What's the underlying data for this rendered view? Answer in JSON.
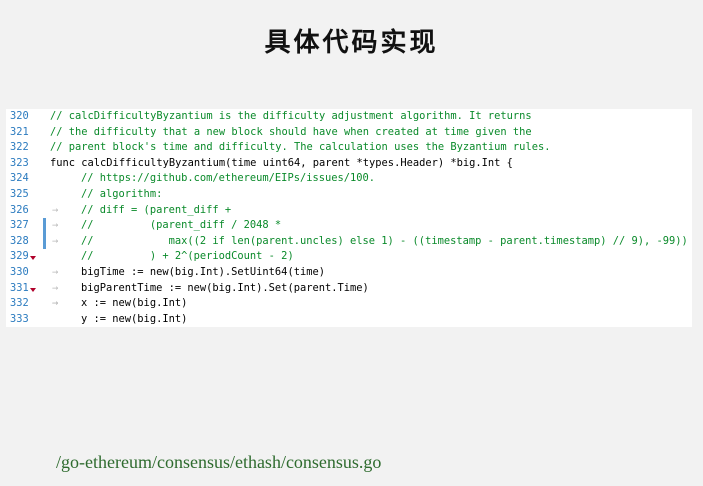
{
  "slide": {
    "title": "具体代码实现",
    "source_path": "/go-ethereum/consensus/ethash/consensus.go"
  },
  "editor": {
    "lines": [
      {
        "number": "320",
        "text": "// calcDifficultyByzantium is the difficulty adjustment algorithm. It returns"
      },
      {
        "number": "321",
        "text": "// the difficulty that a new block should have when created at time given the"
      },
      {
        "number": "322",
        "text": "// parent block's time and difficulty. The calculation uses the Byzantium rules."
      },
      {
        "number": "323",
        "text": "func calcDifficultyByzantium(time uint64, parent *types.Header) *big.Int {"
      },
      {
        "number": "324",
        "text": "// https://github.com/ethereum/EIPs/issues/100."
      },
      {
        "number": "325",
        "text": "// algorithm:"
      },
      {
        "number": "326",
        "text": "// diff = (parent_diff +"
      },
      {
        "number": "327",
        "text": "//         (parent_diff / 2048 *"
      },
      {
        "number": "328",
        "text": "//            max((2 if len(parent.uncles) else 1) - ((timestamp - parent.timestamp) // 9), -99))"
      },
      {
        "number": "329",
        "text": "//         ) + 2^(periodCount - 2)"
      },
      {
        "number": "330",
        "text": "bigTime := new(big.Int).SetUint64(time)"
      },
      {
        "number": "331",
        "text": "bigParentTime := new(big.Int).Set(parent.Time)"
      },
      {
        "number": "332",
        "text": "x := new(big.Int)"
      },
      {
        "number": "333",
        "text": "y := new(big.Int)"
      }
    ]
  }
}
